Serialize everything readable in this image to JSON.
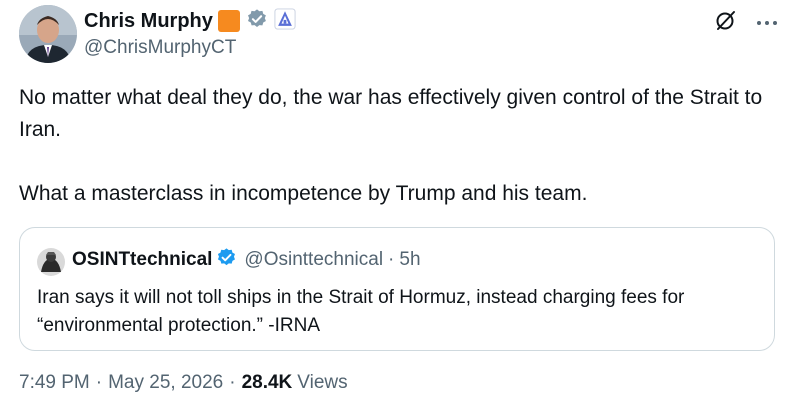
{
  "author": {
    "display_name": "Chris Murphy",
    "handle": "@ChrisMurphyCT",
    "badges": [
      "orange-square-badge",
      "gray-verified-badge",
      "government-affiliate-icon"
    ]
  },
  "header_actions": {
    "grok_icon": "grok-icon",
    "more_icon": "more-icon"
  },
  "tweet": {
    "paragraphs": [
      "No matter what deal they do, the war has effectively given control of the Strait to Iran.",
      "What a masterclass in incompetence by Trump and his team."
    ]
  },
  "quoted_tweet": {
    "display_name": "OSINTtechnical",
    "handle": "@Osinttechnical",
    "separator": "·",
    "time": "5h",
    "text": "Iran says it will not toll ships in the Strait of Hormuz, instead charging fees for “environmental protection.” -IRNA"
  },
  "meta": {
    "time": "7:49 PM",
    "separator": "·",
    "date": "May 25, 2026",
    "views_count": "28.4K",
    "views_label": "Views"
  },
  "colors": {
    "text_primary": "#0f1419",
    "text_secondary": "#536471",
    "border": "#cfd9de",
    "verified_blue": "#1d9bf0",
    "badge_orange": "#f68a1f",
    "badge_gray": "#829aab",
    "affiliate_blue": "#5a6fd6"
  }
}
